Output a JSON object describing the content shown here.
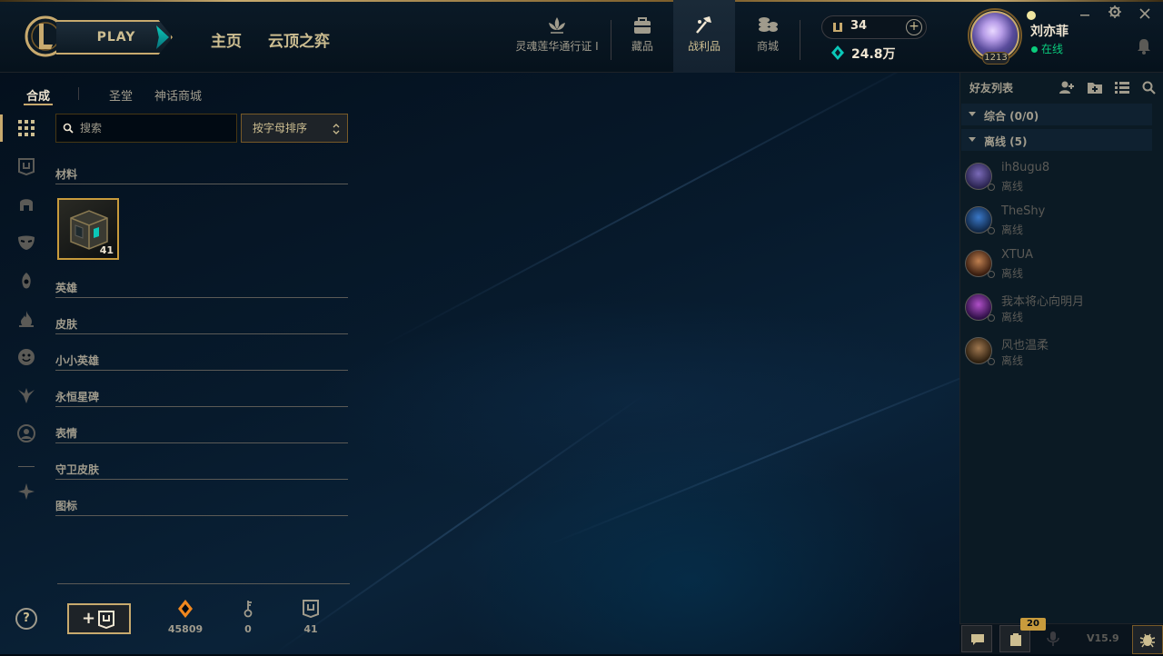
{
  "header": {
    "play_label": "PLAY",
    "nav_home": "主页",
    "nav_tft": "云顶之弈",
    "nav_pass": "灵魂莲华通行证 I",
    "nav_collection": "藏品",
    "nav_loot": "战利品",
    "nav_store": "商城",
    "rp": "34",
    "blue_essence": "24.8万",
    "username": "刘亦菲",
    "status": "在线",
    "level": "1213"
  },
  "subnav": {
    "crafting": "合成",
    "sanctum": "圣堂",
    "mythic_shop": "神话商城"
  },
  "loot": {
    "search_placeholder": "搜索",
    "sort_label": "按字母排序",
    "categories": [
      "材料",
      "英雄",
      "皮肤",
      "小小英雄",
      "永恒星碑",
      "表情",
      "守卫皮肤",
      "图标"
    ],
    "materials": [
      {
        "name": "hextech-chest",
        "count": "41"
      }
    ]
  },
  "resources": {
    "orange_essence": "45809",
    "keys": "0",
    "chests": "41"
  },
  "friends": {
    "title": "好友列表",
    "groups": [
      "综合 (0/0)",
      "离线 (5)"
    ],
    "list": [
      {
        "name": "ih8ugu8",
        "status": "离线"
      },
      {
        "name": "TheShy",
        "status": "离线"
      },
      {
        "name": "XTUA",
        "status": "离线"
      },
      {
        "name": "我本将心向明月",
        "status": "离线"
      },
      {
        "name": "风也温柔",
        "status": "离线"
      }
    ],
    "notification_count": "20",
    "version": "V15.9"
  },
  "colors": {
    "gold": "#c8aa6e",
    "gold_dark": "#785a28",
    "online_green": "#0acb7c",
    "blue_essence": "#0ac8b9",
    "orange_essence": "#f0871e"
  }
}
